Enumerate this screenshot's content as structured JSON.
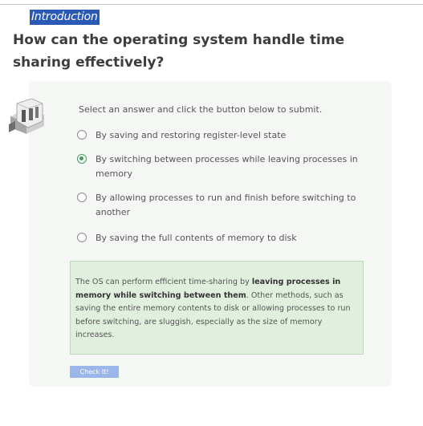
{
  "breadcrumb": "Introduction",
  "question": "How can the operating system handle time sharing effectively?",
  "instruction": "Select an answer and click the button below to submit.",
  "options": [
    {
      "label": "By saving and restoring register-level state",
      "selected": false
    },
    {
      "label": "By switching between processes while leaving processes in memory",
      "selected": true
    },
    {
      "label": "By allowing processes to run and finish before switching to another",
      "selected": false
    },
    {
      "label": "By saving the full contents of memory to disk",
      "selected": false
    }
  ],
  "feedback": {
    "intro": "The OS can perform efficient time-sharing by ",
    "bold": "leaving processes in memory while switching between them",
    "rest": ". Other methods, such as saving the entire memory contents to disk or allowing processes to run before switching, are sluggish, especially as the size of memory increases."
  },
  "submit_label": "Check It!",
  "icon": "server-room-icon",
  "colors": {
    "accent_green": "#3f9a5c",
    "breadcrumb_bg": "#2a5ab5",
    "feedback_bg": "#e1efdf",
    "button_bg": "#9bb7ea"
  }
}
